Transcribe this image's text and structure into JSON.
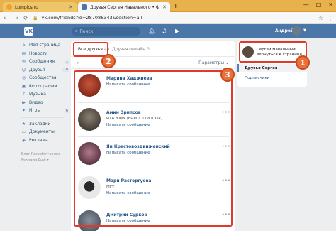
{
  "browser": {
    "tabs": [
      {
        "label": "Lumpics.ru",
        "favicon_color": "#f0a030"
      },
      {
        "label": "Друзья Сергея Навального • Ф",
        "favicon_color": "#4a76a8"
      }
    ],
    "new_tab": "+",
    "window_buttons": [
      "—",
      "□",
      "✕"
    ],
    "url_prefix": "vk.com",
    "url": "vk.com/friends?id=287086343&section=all"
  },
  "vk": {
    "logo": "VK",
    "search_placeholder": "Поиск",
    "username": "Андрей"
  },
  "left_menu": {
    "items": [
      {
        "label": "Моя страница",
        "icon": "home-icon",
        "badge": ""
      },
      {
        "label": "Новости",
        "icon": "news-icon",
        "badge": ""
      },
      {
        "label": "Сообщения",
        "icon": "message-icon",
        "badge": "1"
      },
      {
        "label": "Друзья",
        "icon": "friends-icon",
        "badge": "18"
      },
      {
        "label": "Сообщества",
        "icon": "groups-icon",
        "badge": ""
      },
      {
        "label": "Фотографии",
        "icon": "photo-icon",
        "badge": ""
      },
      {
        "label": "Музыка",
        "icon": "music-icon",
        "badge": ""
      },
      {
        "label": "Видео",
        "icon": "video-icon",
        "badge": ""
      },
      {
        "label": "Игры",
        "icon": "games-icon",
        "badge": "6"
      }
    ],
    "items2": [
      {
        "label": "Закладки",
        "icon": "bookmark-icon"
      },
      {
        "label": "Документы",
        "icon": "document-icon"
      },
      {
        "label": "Реклама",
        "icon": "ads-icon"
      }
    ],
    "footer_line1": "Блог   Разработчикам",
    "footer_line2": "Реклама   Ещё ▾"
  },
  "main": {
    "tab_all_label": "Все друзья",
    "tab_all_count": "49",
    "tab_online_label": "Друзья онлайн",
    "tab_online_count": "3",
    "search_placeholder": "",
    "params_label": "Параметры ⌄",
    "write_label": "Написать сообщение",
    "friends": [
      {
        "name": "Марина Хаджиева",
        "sub": "",
        "avatar_color": "#7a2a20"
      },
      {
        "name": "Амин Эрипсов",
        "sub": "ИТА ЮФУ (бывш. ТТИ ЮФУ)",
        "avatar_color": "#3a3530"
      },
      {
        "name": "Ян Крестовоздвиженский",
        "sub": "",
        "avatar_color": "#4a2a3a"
      },
      {
        "name": "Мари Расторгуева",
        "sub": "МГУ",
        "avatar_color": "#d8d8d8"
      },
      {
        "name": "Дмитрий Сурков",
        "sub": "",
        "avatar_color": "#606878"
      }
    ]
  },
  "right_panel": {
    "user_line1": "Сергей Навальный",
    "user_line2": "вернуться к странице",
    "item_selected": "Друзья Сергея",
    "item_other": "Подписчики"
  },
  "annotations": {
    "num1": "1",
    "num2": "2",
    "num3": "3",
    "color": "#e03a2a"
  }
}
